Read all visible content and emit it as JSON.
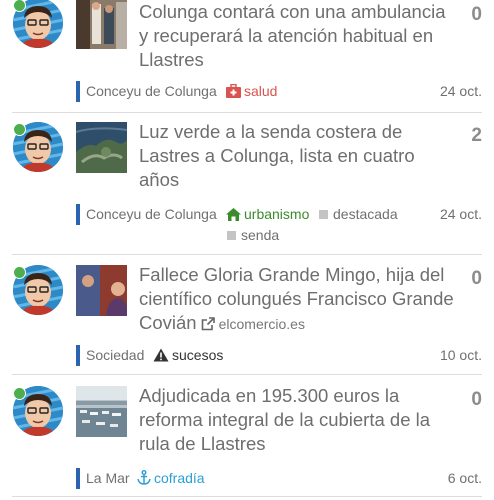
{
  "colors": {
    "category_bar": "#2a64b1",
    "online": "#4cae4c",
    "tag_salud": "#d9534f",
    "tag_urbanismo": "#3c8b2c",
    "tag_sucesos": "#333333",
    "tag_cofradia": "#2a9fd6",
    "tag_plain": "#707070"
  },
  "items": [
    {
      "title": "Colunga contará con una ambulancia y recuperará la atención habitual en Llastres",
      "count": "0",
      "category": "Conceyu de Colunga",
      "tags": [
        {
          "icon": "medkit-icon",
          "label": "salud"
        }
      ],
      "date": "24 oct."
    },
    {
      "title": "Luz verde a la senda costera de Lastres a Colunga, lista en cuatro años",
      "count": "2",
      "category": "Conceyu de Colunga",
      "tags": [
        {
          "icon": "home-icon",
          "label": "urbanismo"
        },
        {
          "icon": "square-icon",
          "label": "destacada"
        },
        {
          "icon": "square-icon",
          "label": "senda"
        }
      ],
      "date": "24 oct."
    },
    {
      "title": "Fallece Gloria Grande Mingo, hija del científico colungués Francisco Grande Covián",
      "domain": "elcomercio.es",
      "count": "0",
      "category": "Sociedad",
      "tags": [
        {
          "icon": "warning-icon",
          "label": "sucesos"
        }
      ],
      "date": "10 oct."
    },
    {
      "title": "Adjudicada en 195.300 euros la reforma integral de la cubierta de la rula de Llastres",
      "count": "0",
      "category": "La Mar",
      "tags": [
        {
          "icon": "anchor-icon",
          "label": "cofradía"
        }
      ],
      "date": "6 oct."
    }
  ]
}
